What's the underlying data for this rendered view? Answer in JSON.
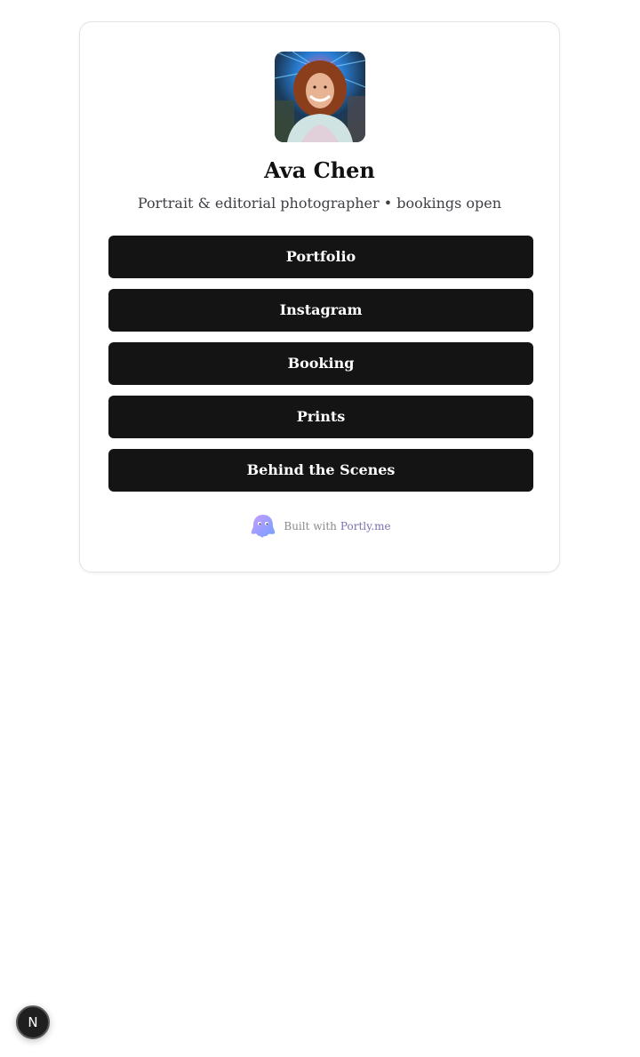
{
  "profile": {
    "name": "Ava Chen",
    "bio": "Portrait & editorial photographer • bookings open",
    "avatar_icon": "profile-photo"
  },
  "links": [
    {
      "label": "Portfolio"
    },
    {
      "label": "Instagram"
    },
    {
      "label": "Booking"
    },
    {
      "label": "Prints"
    },
    {
      "label": "Behind the Scenes"
    }
  ],
  "footer": {
    "prefix": "Built with",
    "brand": "Portly.me",
    "mascot_icon": "ghost-mascot-icon"
  },
  "dev_badge": {
    "label": "N"
  },
  "colors": {
    "button_bg": "#141414",
    "button_text": "#ffffff",
    "brand_link": "#7c6fb0",
    "card_border": "#e4e4e7"
  }
}
